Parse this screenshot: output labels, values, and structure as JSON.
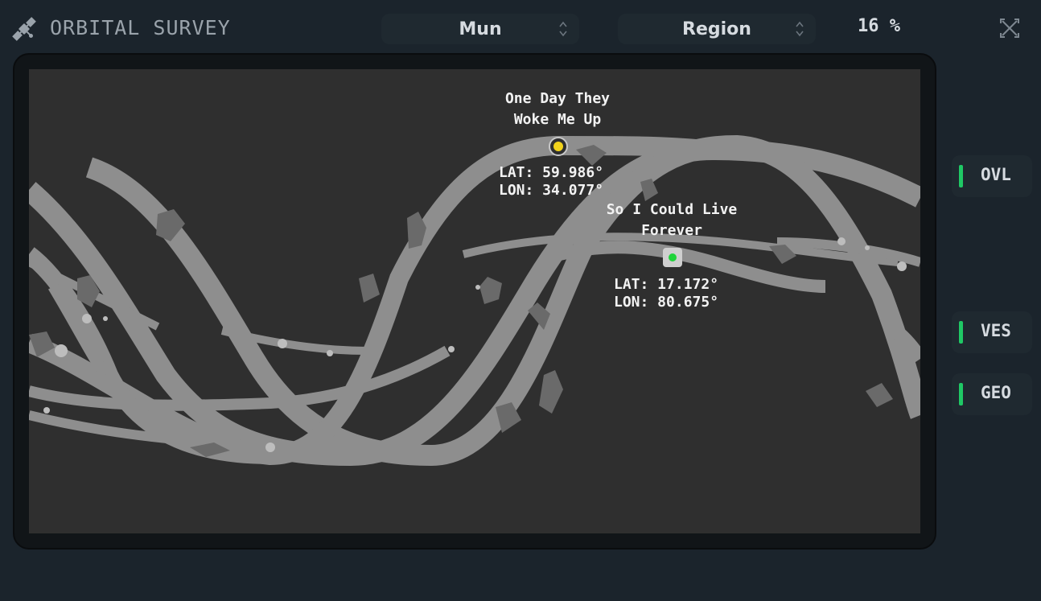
{
  "header": {
    "title": "ORBITAL SURVEY",
    "icon": "satellite-icon",
    "body_selector": {
      "value": "Mun"
    },
    "mode_selector": {
      "value": "Region"
    },
    "coverage": "16 %",
    "close_icon": "close-icon"
  },
  "map": {
    "vessels": [
      {
        "name": "One Day They\nWoke Me Up",
        "coords": "LAT: 59.986°\nLON: 34.077°",
        "marker_color": "#f2d31b"
      },
      {
        "name": "So I Could Live\nForever",
        "coords": "LAT: 17.172°\nLON: 80.675°",
        "marker_color": "#1fd43a"
      }
    ]
  },
  "sidebar": {
    "buttons": [
      {
        "label": "OVL",
        "indicator_color": "#1fc865"
      },
      {
        "label": "VES",
        "indicator_color": "#1fc865"
      },
      {
        "label": "GEO",
        "indicator_color": "#1fc865"
      }
    ]
  },
  "colors": {
    "background": "#1b242c",
    "map_background": "#2f2f2f",
    "scanned_track": "#8e8e8e",
    "terrain_dark": "#6a6a6a"
  }
}
